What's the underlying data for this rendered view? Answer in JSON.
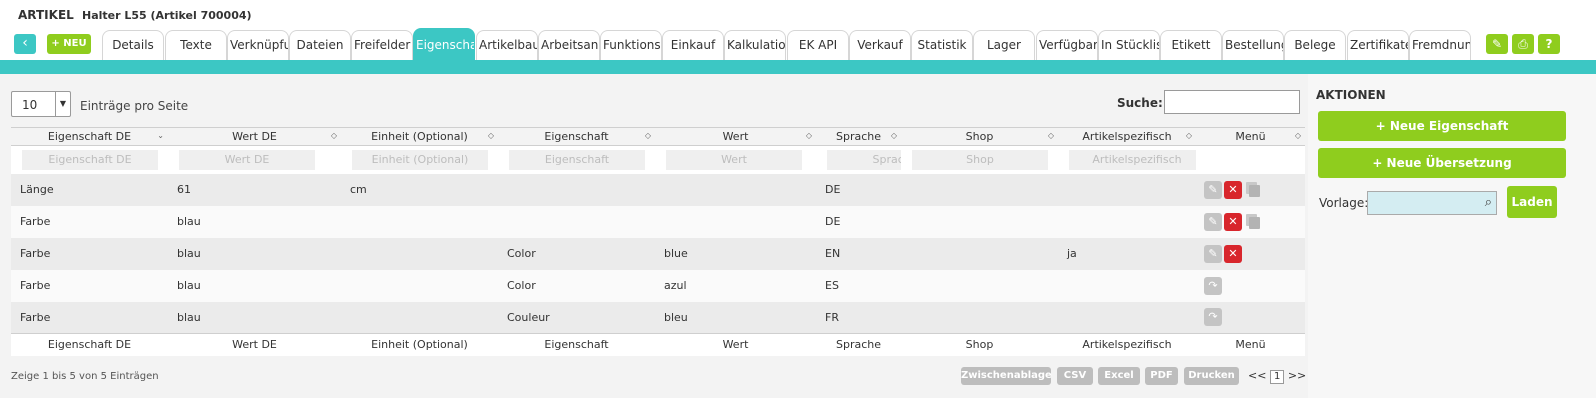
{
  "header": {
    "app": "ARTIKEL",
    "document": "Halter L55 (Artikel 700004)"
  },
  "toolbar": {
    "back_icon": "arrow-left-icon",
    "back_glyph": "‹",
    "new_label": "+ NEU"
  },
  "tabs": [
    {
      "label": "Details"
    },
    {
      "label": "Texte"
    },
    {
      "label": "Verknüpfungen"
    },
    {
      "label": "Dateien"
    },
    {
      "label": "Freifelder"
    },
    {
      "label": "Eigenschaften",
      "active": true
    },
    {
      "label": "Artikelbaum"
    },
    {
      "label": "Arbeitsanweisung"
    },
    {
      "label": "Funktionsprotokoll"
    },
    {
      "label": "Einkauf"
    },
    {
      "label": "Kalkulation"
    },
    {
      "label": "EK API"
    },
    {
      "label": "Verkauf"
    },
    {
      "label": "Statistik"
    },
    {
      "label": "Lager"
    },
    {
      "label": "Verfügbarkeit"
    },
    {
      "label": "In Stückliste"
    },
    {
      "label": "Etikett"
    },
    {
      "label": "Bestellungen"
    },
    {
      "label": "Belege"
    },
    {
      "label": "Zertifikate"
    },
    {
      "label": "Fremdnummern"
    }
  ],
  "tool_icons": {
    "edit": "✎",
    "print": "⎙",
    "help": "?"
  },
  "list": {
    "per_page_value": "10",
    "per_page_label": "Einträge pro Seite",
    "search_label": "Suche:",
    "columns": [
      "Eigenschaft DE",
      "Wert DE",
      "Einheit (Optional)",
      "Eigenschaft",
      "Wert",
      "Sprache",
      "Shop",
      "Artikelspezifisch",
      "Menü"
    ],
    "filters": [
      "Eigenschaft DE",
      "Wert DE",
      "Einheit (Optional)",
      "Eigenschaft",
      "Wert",
      "Sprache",
      "Shop",
      "Artikelspezifisch"
    ],
    "rows": [
      {
        "eigenschaft_de": "Länge",
        "wert_de": "61",
        "einheit": "cm",
        "eigenschaft": "",
        "wert": "",
        "sprache": "DE",
        "shop": "",
        "spezifisch": "",
        "actions": [
          "edit",
          "delete",
          "copy"
        ]
      },
      {
        "eigenschaft_de": "Farbe",
        "wert_de": "blau",
        "einheit": "",
        "eigenschaft": "",
        "wert": "",
        "sprache": "DE",
        "shop": "",
        "spezifisch": "",
        "actions": [
          "edit",
          "delete",
          "copy"
        ]
      },
      {
        "eigenschaft_de": "Farbe",
        "wert_de": "blau",
        "einheit": "",
        "eigenschaft": "Color",
        "wert": "blue",
        "sprache": "EN",
        "shop": "",
        "spezifisch": "ja",
        "actions": [
          "edit",
          "delete"
        ]
      },
      {
        "eigenschaft_de": "Farbe",
        "wert_de": "blau",
        "einheit": "",
        "eigenschaft": "Color",
        "wert": "azul",
        "sprache": "ES",
        "shop": "",
        "spezifisch": "",
        "actions": [
          "redo"
        ]
      },
      {
        "eigenschaft_de": "Farbe",
        "wert_de": "blau",
        "einheit": "",
        "eigenschaft": "Couleur",
        "wert": "bleu",
        "sprache": "FR",
        "shop": "",
        "spezifisch": "",
        "actions": [
          "redo"
        ]
      }
    ],
    "status": "Zeige 1 bis 5 von 5 Einträgen",
    "export_buttons": [
      "Zwischenablage",
      "CSV",
      "Excel",
      "PDF",
      "Drucken"
    ],
    "pager": {
      "prev": "<<",
      "page": "1",
      "next": ">>"
    }
  },
  "sidebar": {
    "title": "AKTIONEN",
    "new_property": "+ Neue Eigenschaft",
    "new_translation": "+ Neue Übersetzung",
    "template_label": "Vorlage:",
    "load_label": "Laden"
  },
  "colors": {
    "accent": "#3cc7c4",
    "green": "#8fcd1e",
    "delete": "#d8262c"
  }
}
